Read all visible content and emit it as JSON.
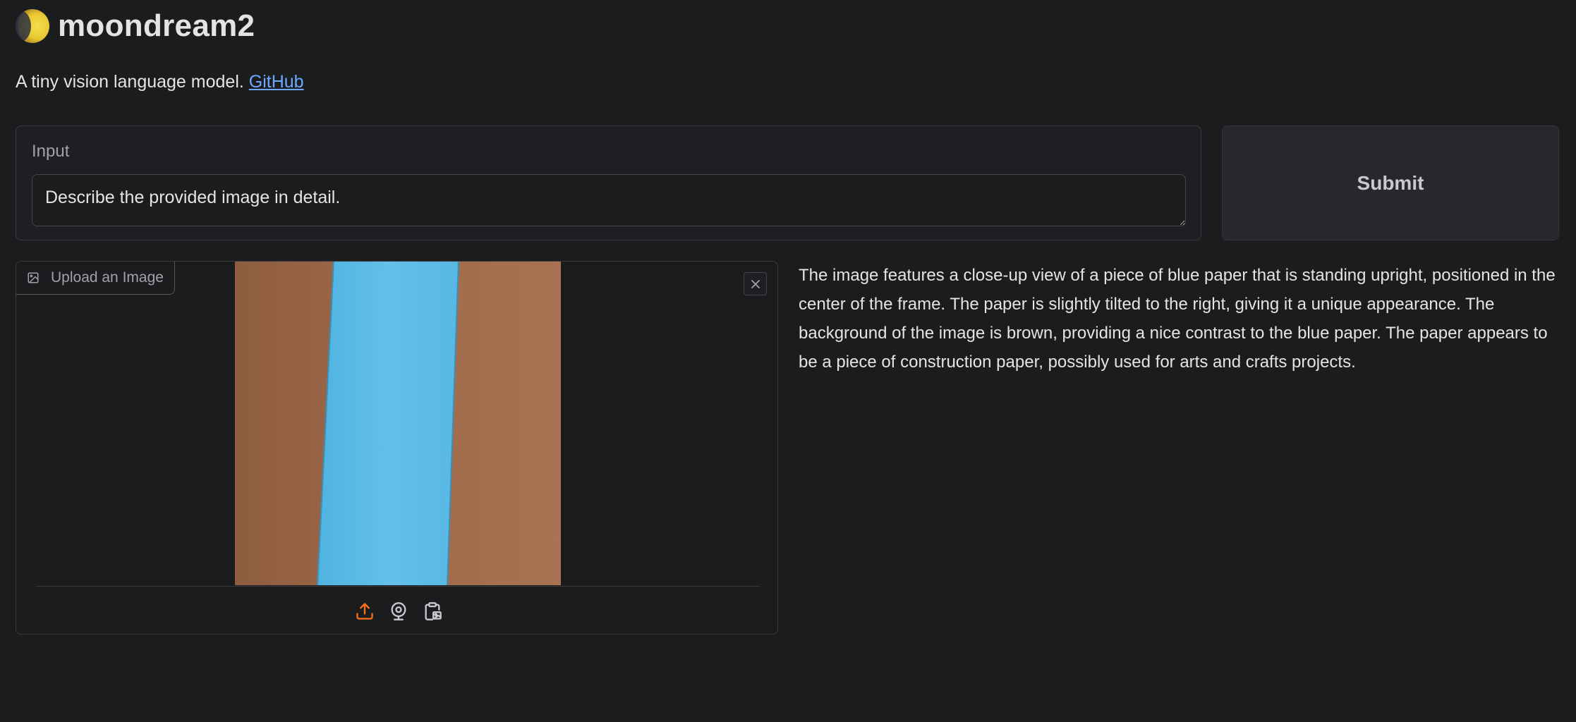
{
  "header": {
    "title": "moondream2",
    "subtitle": "A tiny vision language model.",
    "github_link": "GitHub"
  },
  "input": {
    "label": "Input",
    "value": "Describe the provided image in detail."
  },
  "submit": {
    "label": "Submit"
  },
  "image_panel": {
    "tab_label": "Upload an Image",
    "tab_icon": "image-icon",
    "close_icon": "close-icon",
    "tools": [
      "upload-icon",
      "webcam-icon",
      "clipboard-icon"
    ]
  },
  "output": {
    "text": "The image features a close-up view of a piece of blue paper that is standing upright, positioned in the center of the frame. The paper is slightly tilted to the right, giving it a unique appearance. The background of the image is brown, providing a nice contrast to the blue paper. The paper appears to be a piece of construction paper, possibly used for arts and crafts projects."
  },
  "colors": {
    "background": "#1b1c1e",
    "link": "#6ea8fe",
    "accent_orange": "#f97316",
    "photo_brown": "#a0694a",
    "photo_blue": "#5bbce6"
  }
}
